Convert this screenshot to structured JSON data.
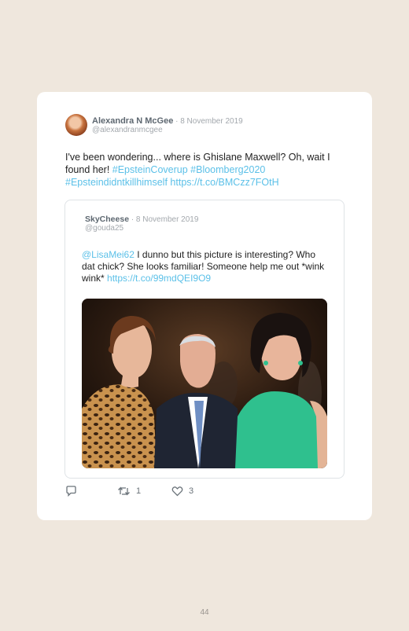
{
  "tweet": {
    "author_name": "Alexandra N McGee",
    "date": " · 8 November 2019",
    "handle": "@alexandranmcgee",
    "text_plain": "I've been wondering... where is Ghislane Maxwell? Oh, wait I found her! ",
    "hashtag_1": "#EpsteinCoverup",
    "hashtag_2": "#Bloomberg2020",
    "hashtag_3": "#Epsteindidntkillhimself",
    "link": "https://t.co/BMCzz7FOtH"
  },
  "quoted_tweet": {
    "author_name": "SkyCheese",
    "date": " · 8 November 2019",
    "handle": "@gouda25",
    "mention": "@LisaMei62",
    "text_plain": " I dunno but this picture is interesting? Who dat chick? She looks familiar! Someone help me out *wink wink* ",
    "link": "https://t.co/99mdQEI9O9"
  },
  "actions": {
    "retweet_count": "1",
    "like_count": "3"
  },
  "page_number": "44",
  "colors": {
    "background": "#efe7dd",
    "card": "#ffffff",
    "link": "#5bc0e8",
    "name": "#5d6770",
    "meta": "#a3a8ad"
  }
}
